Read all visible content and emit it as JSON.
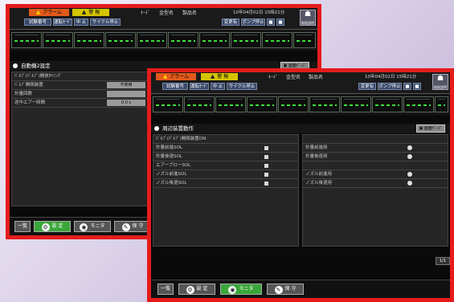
{
  "back": {
    "alarm_label": "アラーム",
    "warning_label": "警 報",
    "header_labels": [
      "ｷｰﾄﾞ",
      "金型名",
      "製品名"
    ],
    "datetime": "10年04月02日 15時21分",
    "status_cells": [
      "試験番号",
      "運転ﾓｰﾄﾞ",
      "中 止",
      "サイクル停止"
    ],
    "right_cells": [
      "変更有",
      "ポンプ停止",
      "■",
      "■"
    ],
    "help_label": "取扱説明",
    "section_title": "自動機2設定",
    "page_button": "画面ﾍﾟｰｼﾞ",
    "rows": [
      {
        "label": "ﾊﾞﾙﾌﾞ(ﾊﾟﾙﾌﾟ)開放ﾀｲﾐﾝｸﾞ",
        "value": ""
      },
      {
        "label": "ﾊﾞﾙﾌﾞ開閉装置",
        "value": "不使用"
      },
      {
        "label": "計量回数",
        "value": ""
      },
      {
        "label": "途中エアー時間",
        "value": "0.0 s"
      }
    ],
    "bottom_buttons": [
      "一覧",
      "設 定",
      "モニタ",
      "保 守"
    ]
  },
  "front": {
    "alarm_label": "アラーム",
    "warning_label": "警 報",
    "header_labels": [
      "ｷｰﾄﾞ",
      "金型名",
      "製品名"
    ],
    "datetime": "10年04月02日 15時21分",
    "status_cells": [
      "試験番号",
      "運転ﾓｰﾄﾞ",
      "中 止",
      "サイクル停止"
    ],
    "right_cells": [
      "変更有",
      "ポンプ停止",
      "■",
      "■"
    ],
    "help_label": "取扱説明",
    "section_title": "周辺装置動作",
    "page_button": "画面ﾍﾟｰｼﾞ",
    "left_rows": [
      {
        "label": "ﾊﾞﾙﾌﾞ(ﾊﾟﾙﾌﾟ)開閉装置ON"
      },
      {
        "label": "計量前進SOL"
      },
      {
        "label": "計量後退SOL"
      },
      {
        "label": "エアーブローSOL"
      },
      {
        "label": "ノズル前進SOL"
      },
      {
        "label": "ノズル後退SOL"
      }
    ],
    "right_rows": [
      {
        "label": ""
      },
      {
        "label": "計量前進用"
      },
      {
        "label": "計量後退用"
      },
      {
        "label": ""
      },
      {
        "label": "ノズル前進用"
      },
      {
        "label": "ノズル後退用"
      }
    ],
    "page_indicator": "1/1",
    "bottom_buttons": [
      "一覧",
      "設 定",
      "モニタ",
      "保 守"
    ]
  },
  "colors": {
    "frame": "#e41c1c",
    "alarm": "#e05a1a",
    "warning": "#d4c400",
    "active": "#3aa63a",
    "monitor_dash": "#3de03d"
  }
}
